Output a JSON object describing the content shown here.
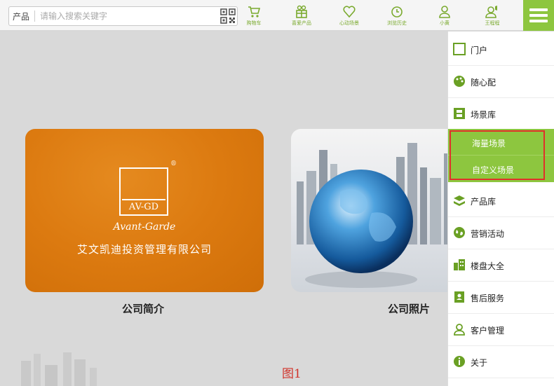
{
  "search": {
    "category": "产品",
    "placeholder": "请输入搜索关键字"
  },
  "nav": [
    {
      "label": "购物车",
      "icon": "cart-icon"
    },
    {
      "label": "喜爱产品",
      "icon": "gift-icon"
    },
    {
      "label": "心动场景",
      "icon": "heart-icon"
    },
    {
      "label": "浏览历史",
      "icon": "clock-icon"
    },
    {
      "label": "小黄",
      "icon": "user-icon"
    },
    {
      "label": "王程程",
      "icon": "user-speaker-icon"
    }
  ],
  "colors": {
    "brand_green": "#8dc63f",
    "orange": "#dc7a10",
    "highlight_red": "#e0302a"
  },
  "cards": {
    "company_intro": {
      "logo_text": "AV-GD",
      "registered_mark": "®",
      "logo_script": "Avant-Garde",
      "company_name": "艾文凯迪投资管理有限公司",
      "caption": "公司简介"
    },
    "company_photos": {
      "caption": "公司照片"
    }
  },
  "figure_label": "图1",
  "side_menu": {
    "items": [
      {
        "label": "门户",
        "icon": "square-outline-icon"
      },
      {
        "label": "随心配",
        "icon": "palette-icon"
      },
      {
        "label": "场景库",
        "icon": "film-icon"
      },
      {
        "label": "产品库",
        "icon": "box-stack-icon"
      },
      {
        "label": "营销活动",
        "icon": "globe-icon"
      },
      {
        "label": "楼盘大全",
        "icon": "buildings-icon"
      },
      {
        "label": "售后服务",
        "icon": "contact-book-icon"
      },
      {
        "label": "客户管理",
        "icon": "person-outline-icon"
      },
      {
        "label": "关于",
        "icon": "info-icon"
      }
    ],
    "sub_items": [
      {
        "label": "海量场景"
      },
      {
        "label": "自定义场景"
      }
    ]
  }
}
